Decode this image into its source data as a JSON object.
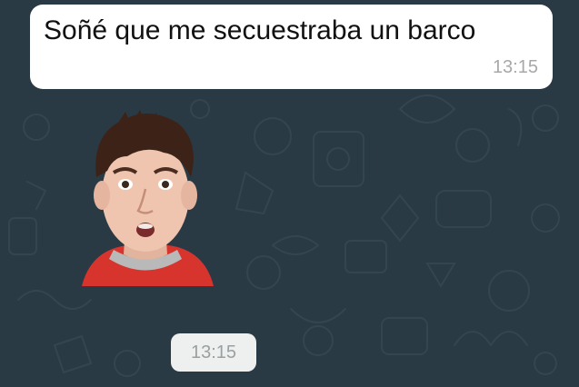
{
  "chat": {
    "background_color": "#2a3a44",
    "messages": [
      {
        "type": "text",
        "text": "Soñé que me secuestraba un barco",
        "time": "13:15"
      },
      {
        "type": "sticker",
        "sticker": "boy-shocked-face-sticker",
        "time": "13:15"
      }
    ]
  }
}
